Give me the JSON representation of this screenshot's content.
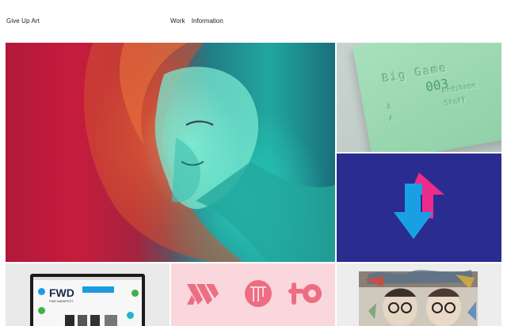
{
  "site": {
    "logo": "Give Up Art",
    "nav": [
      "Work",
      "Information"
    ]
  },
  "tiles": {
    "card": {
      "line1": "Big Game",
      "number": "003",
      "left_a": "A",
      "right_a": "Redshape",
      "left_b": "A",
      "right_b": "Staff"
    },
    "monitor": {
      "brand": "FWD",
      "subline": "FWD MANIFEST"
    }
  },
  "colors": {
    "arrows_bg": "#2a2d8f",
    "arrow_blue": "#19a0e4",
    "arrow_pink": "#ec2b8a",
    "logos_bg": "#f9d7dc",
    "logos_mark": "#ee6d82"
  }
}
